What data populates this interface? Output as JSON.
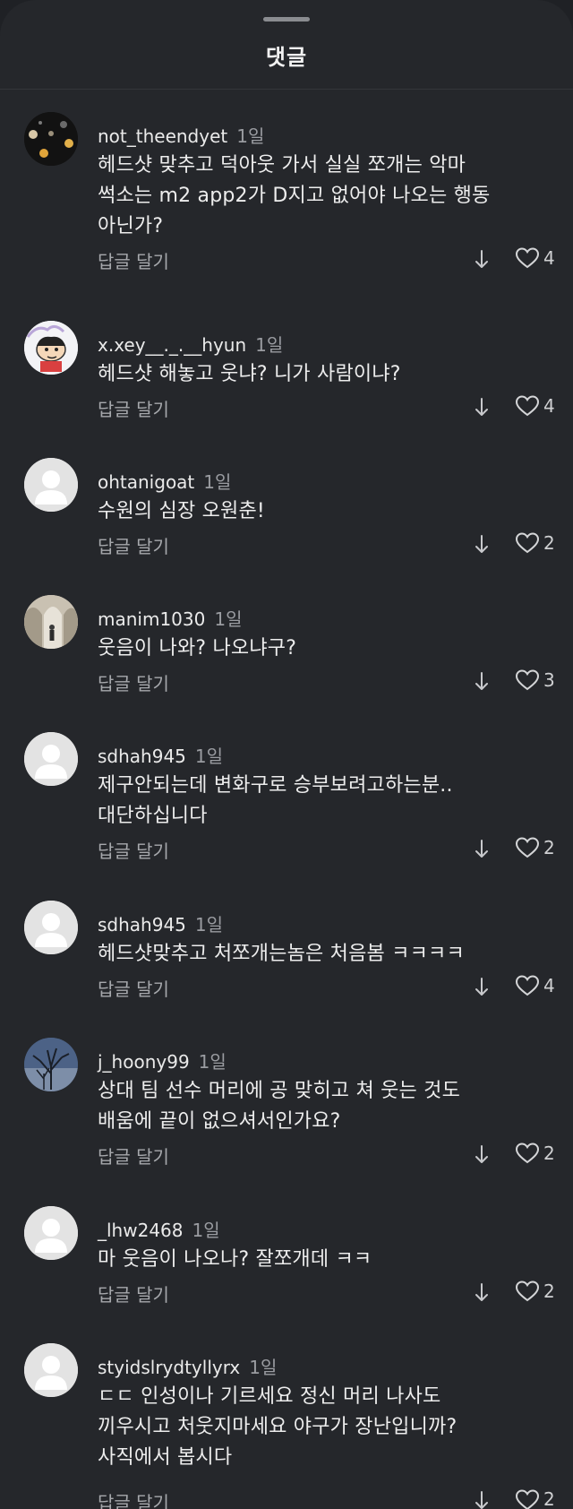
{
  "sheet": {
    "title": "댓글"
  },
  "comments": [
    {
      "username": "not_theendyet",
      "time": "1일",
      "lines": [
        "헤드샷 맞추고 덕아웃 가서 실실 쪼개는 악마",
        "썩소는 m2 app2가 D지고 없어야 나오는 행동",
        "아닌가?"
      ],
      "reply_label": "답글 달기",
      "likes": "4",
      "avatar": "photo-night-lights"
    },
    {
      "username": "x.xey__._.__hyun",
      "time": "1일",
      "lines": [
        "헤드샷 해놓고 웃냐? 니가 사람이냐?"
      ],
      "reply_label": "답글 달기",
      "likes": "4",
      "avatar": "cartoon-character"
    },
    {
      "username": "ohtanigoat",
      "time": "1일",
      "lines": [
        "수원의 심장 오원춘!"
      ],
      "reply_label": "답글 달기",
      "likes": "2",
      "avatar": "default-person"
    },
    {
      "username": "manim1030",
      "time": "1일",
      "lines": [
        "웃음이 나와? 나오냐구?"
      ],
      "reply_label": "답글 달기",
      "likes": "3",
      "avatar": "photo-arches"
    },
    {
      "username": "sdhah945",
      "time": "1일",
      "lines": [
        "제구안되는데 변화구로 승부보려고하는분..",
        "대단하십니다"
      ],
      "reply_label": "답글 달기",
      "likes": "2",
      "avatar": "default-person"
    },
    {
      "username": "sdhah945",
      "time": "1일",
      "lines": [
        "헤드샷맞추고 처쪼개는놈은 처음봄 ㅋㅋㅋㅋ"
      ],
      "reply_label": "답글 달기",
      "likes": "4",
      "avatar": "default-person"
    },
    {
      "username": "j_hoony99",
      "time": "1일",
      "lines": [
        "상대 팀 선수 머리에 공 맞히고 쳐 웃는 것도",
        "배움에 끝이 없으셔서인가요?"
      ],
      "reply_label": "답글 달기",
      "likes": "2",
      "avatar": "photo-tree"
    },
    {
      "username": "_lhw2468",
      "time": "1일",
      "lines": [
        "마 웃음이 나오나? 잘쪼개데 ㅋㅋ"
      ],
      "reply_label": "답글 달기",
      "likes": "2",
      "avatar": "default-person"
    },
    {
      "username": "styidslrydtyllyrx",
      "time": "1일",
      "lines": [
        "ㄷㄷ 인성이나 기르세요 정신 머리 나사도",
        "끼우시고 처웃지마세요 야구가 장난입니까?",
        "사직에서 봅시다"
      ],
      "reply_label": "답글 달기",
      "likes": "2",
      "avatar": "default-person"
    }
  ]
}
